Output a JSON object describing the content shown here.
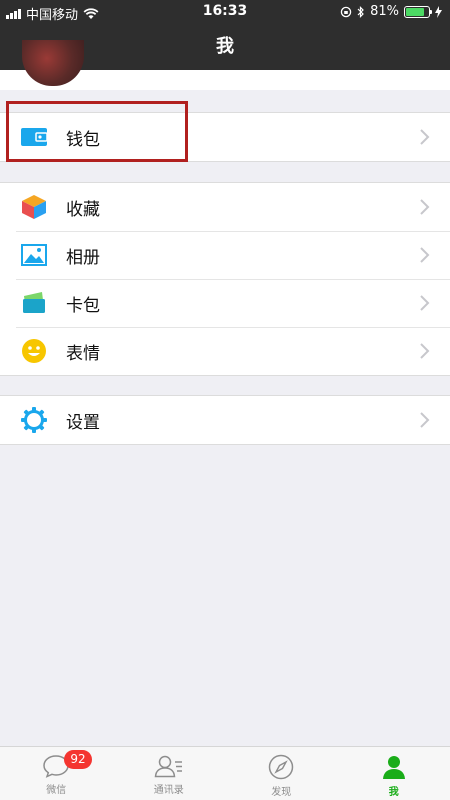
{
  "status_bar": {
    "carrier": "中国移动",
    "time": "16:33",
    "battery": "81%",
    "battery_level": 0.81
  },
  "nav": {
    "title": "我"
  },
  "wallet_group": [
    {
      "label": "钱包",
      "icon": "wallet-icon",
      "color": "#1aa7ec"
    }
  ],
  "main_group": [
    {
      "label": "收藏",
      "icon": "favorites-cube-icon"
    },
    {
      "label": "相册",
      "icon": "album-picture-icon"
    },
    {
      "label": "卡包",
      "icon": "card-wallet-icon"
    },
    {
      "label": "表情",
      "icon": "smiley-face-icon"
    }
  ],
  "settings_group": [
    {
      "label": "设置",
      "icon": "gear-icon"
    }
  ],
  "tab_bar": {
    "tabs": [
      {
        "label": "微信",
        "icon": "chat-bubble-icon"
      },
      {
        "label": "通讯录",
        "icon": "contacts-icon"
      },
      {
        "label": "发现",
        "icon": "compass-icon"
      },
      {
        "label": "我",
        "icon": "person-icon"
      }
    ],
    "badge": "92",
    "active_color": "#1aad19"
  }
}
